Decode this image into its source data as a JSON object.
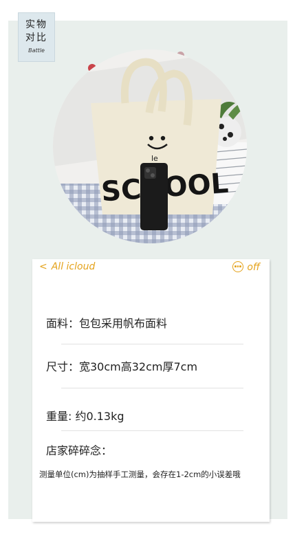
{
  "badge": {
    "line1": "实物",
    "line2": "对比",
    "sub": "Battle"
  },
  "colors": {
    "accent": "#e4a21a",
    "panel": "#e9efec",
    "dot": "#c9444a"
  },
  "photo": {
    "description_icon": "tote-bag-photo",
    "bag_text": "SCHOOL",
    "smile_text": "le"
  },
  "card": {
    "header": {
      "back_label": "All icloud",
      "back_icon": "chevron-left-icon",
      "more_label": "off",
      "more_icon": "ellipsis-circle-icon"
    },
    "material": "面料：包包采用帆布面料",
    "size": "尺寸：宽30cm高32cm厚7cm",
    "weight": "重量:  约0.13kg",
    "shop_notes_title": "店家碎碎念：",
    "note": "测量单位(cm)为抽样手工测量，会存在1-2cm的小误差哦"
  }
}
